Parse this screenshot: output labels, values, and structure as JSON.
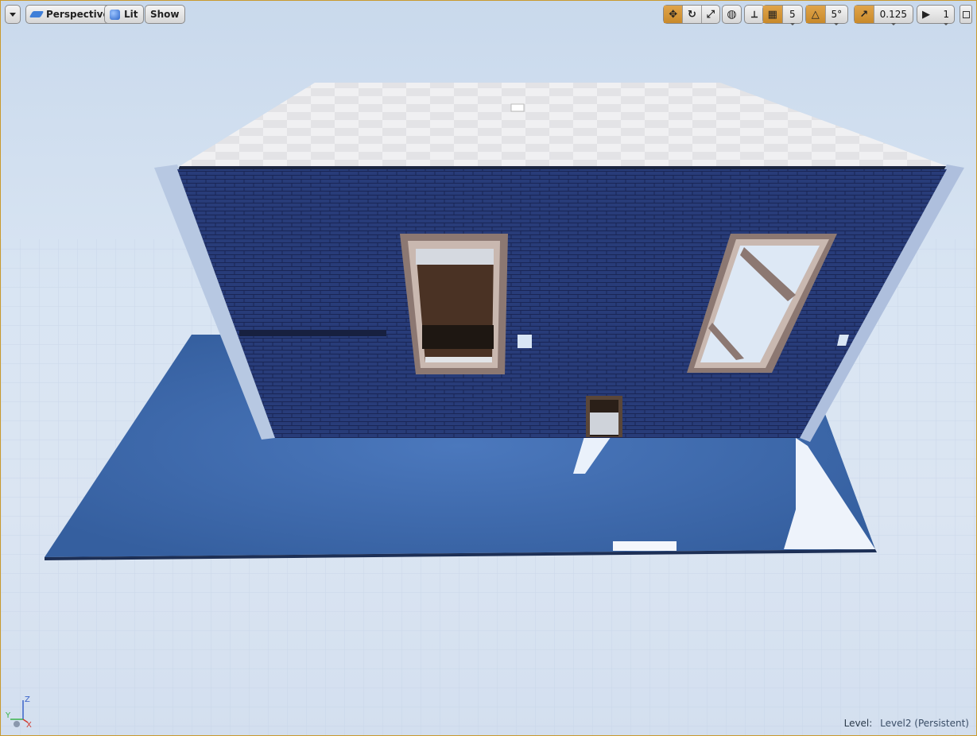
{
  "toolbar": {
    "view_mode": "Perspective",
    "lighting": "Lit",
    "show": "Show",
    "grid_snap_value": "5",
    "rotation_snap_value": "5°",
    "scale_snap_value": "0.125",
    "camera_speed": "1"
  },
  "status": {
    "level_label": "Level:",
    "level_name": "Level2 (Persistent)"
  },
  "axes": {
    "z": "Z",
    "y": "Y",
    "x": "X"
  },
  "colors": {
    "accent": "#c98a2b",
    "brick": "#2b3f7a",
    "floor": "#3f6db4",
    "sky": "#d5e2f1",
    "border": "#c99a2e"
  }
}
